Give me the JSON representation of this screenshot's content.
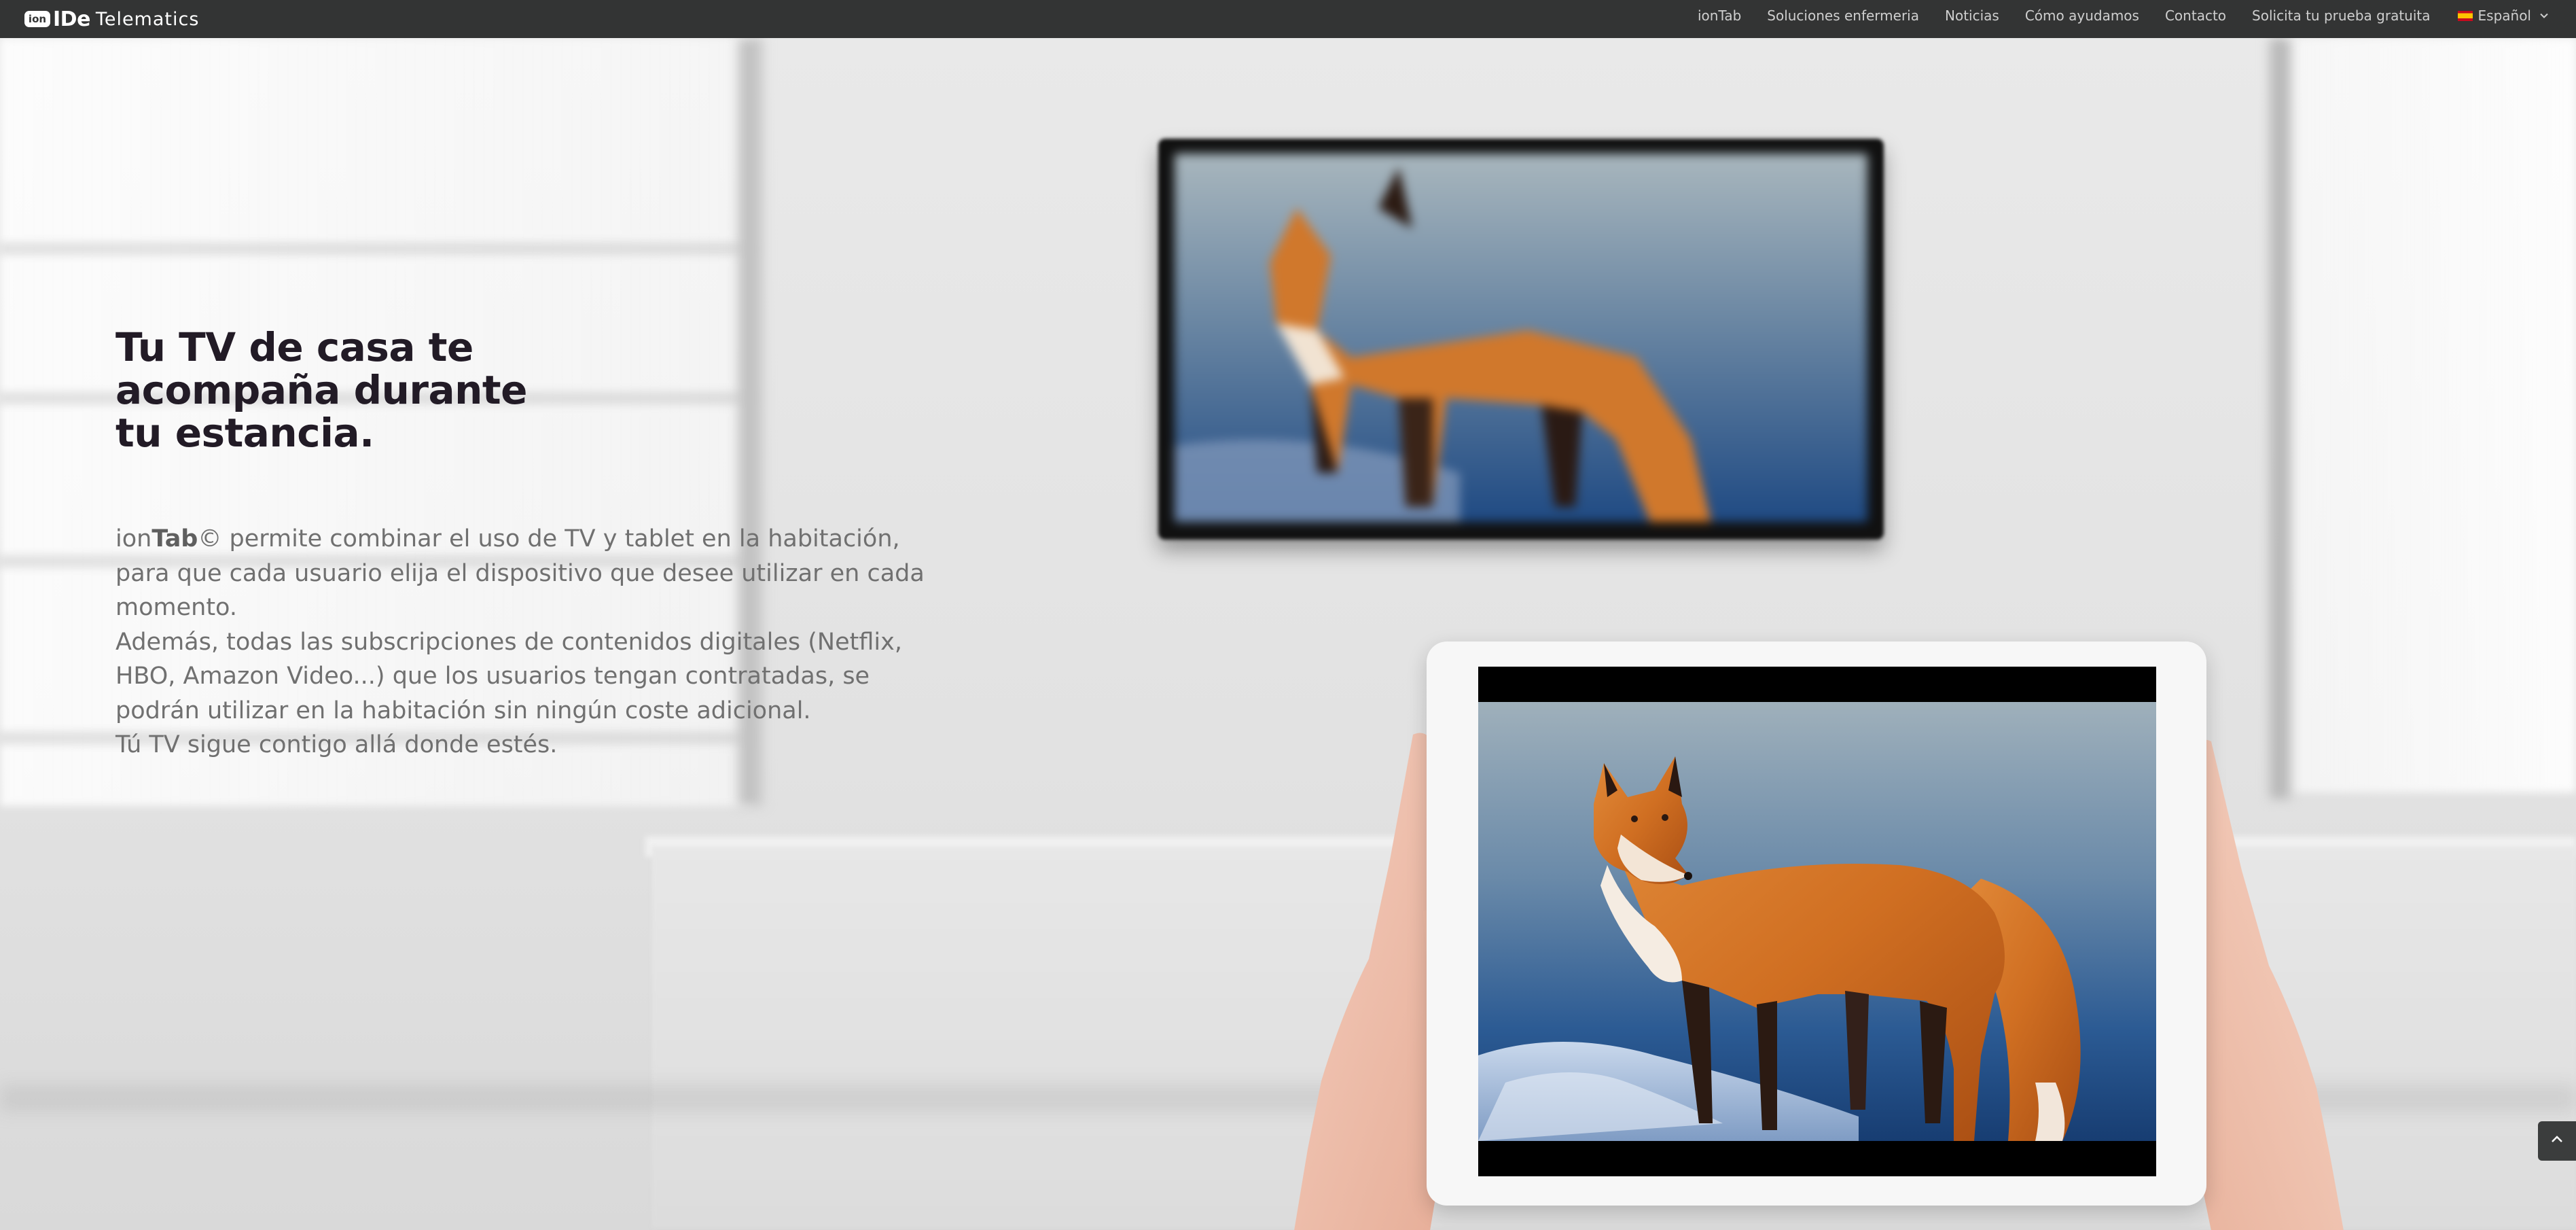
{
  "brand": {
    "badge": "ion",
    "name_bold": "IDe",
    "name_rest": "Telematics"
  },
  "nav": {
    "items": [
      {
        "label": "ionTab"
      },
      {
        "label": "Soluciones enfermeria"
      },
      {
        "label": "Noticias"
      },
      {
        "label": "Cómo ayudamos"
      },
      {
        "label": "Contacto"
      },
      {
        "label": "Solicita tu prueba gratuita"
      }
    ],
    "language": {
      "label": "Español",
      "flag_icon": "spain-flag-icon",
      "dropdown_icon": "chevron-down-icon"
    }
  },
  "hero": {
    "headline_lines": [
      "Tu TV de casa te",
      "acompaña durante",
      "tu estancia."
    ],
    "paragraph": {
      "line1_prefix": "ion",
      "line1_bold": "Tab",
      "line1_rest": "© permite combinar el uso de TV y tablet en la habitación,",
      "line2": "para que cada usuario elija el dispositivo que desee utilizar en cada",
      "line3": "momento.",
      "line4": "Además, todas las subscripciones de contenidos digitales (Netflix,",
      "line5": "HBO, Amazon Video...) que los usuarios tengan contratadas, se",
      "line6": "podrán utilizar en la habitación sin ningún coste adicional.",
      "line7": "Tú TV sigue contigo allá donde estés."
    }
  },
  "scroll_top": {
    "icon": "chevron-up-icon"
  },
  "colors": {
    "topbar": "#333434",
    "headline": "#221b26",
    "body_text": "#707070",
    "fox_orange": "#d9772b",
    "sky_blue": "#7f99ad",
    "deep_blue": "#1d4677"
  }
}
